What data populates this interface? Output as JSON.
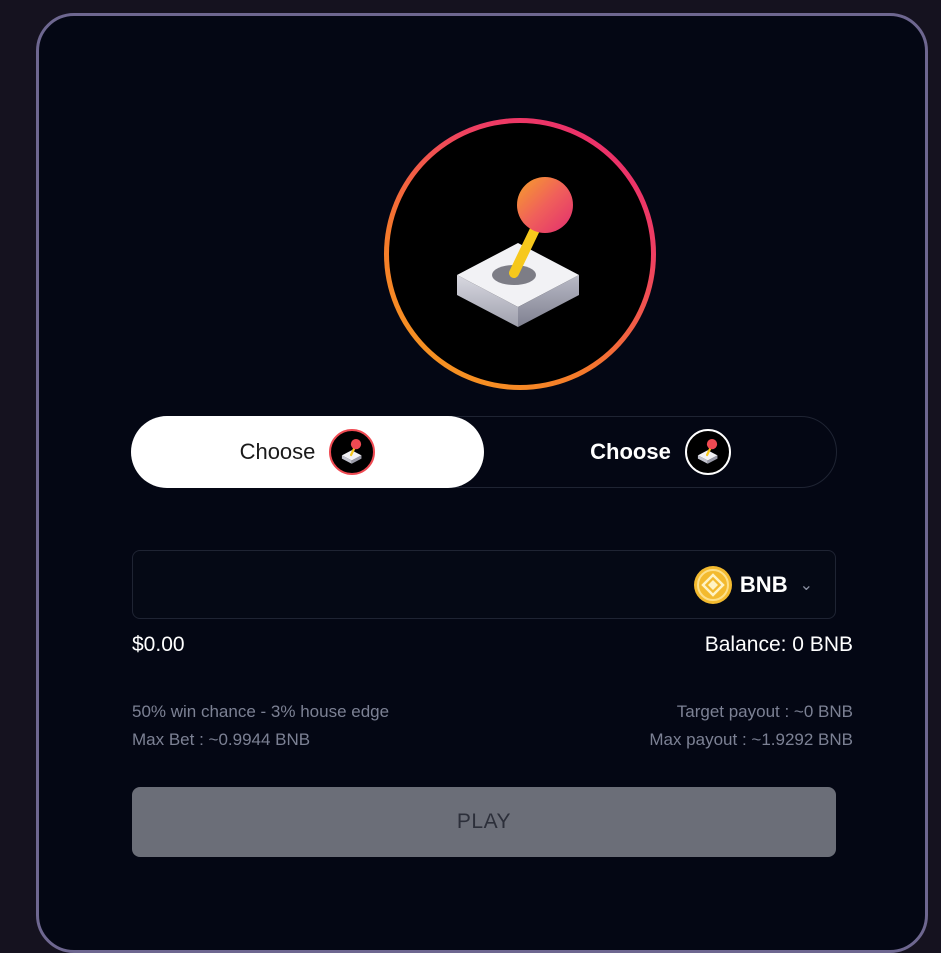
{
  "hero": {
    "icon": "joystick-icon",
    "ring_gradient": [
      "#f7a21b",
      "#e8256f"
    ]
  },
  "toggle": {
    "option_1": {
      "label": "Choose",
      "icon": "joystick-icon",
      "selected": true
    },
    "option_2": {
      "label": "Choose",
      "icon": "joystick-icon",
      "selected": false
    }
  },
  "bet": {
    "amount_value": "",
    "token": {
      "symbol": "BNB",
      "icon": "bnb-coin-icon",
      "color": "#f3ba2f"
    },
    "usd_value": "$0.00",
    "balance": "Balance: 0 BNB"
  },
  "info": {
    "win_chance": "50% win chance - 3% house edge",
    "max_bet": "Max Bet : ~0.9944 BNB",
    "target_payout": "Target payout : ~0 BNB",
    "max_payout": "Max payout : ~1.9292 BNB"
  },
  "play_button": {
    "label": "PLAY",
    "enabled": false
  },
  "colors": {
    "background": "#15121f",
    "card": "#040714",
    "card_border": "#6e6790",
    "accent_orange": "#f5782c",
    "accent_pink": "#e8256f",
    "button_disabled": "#6b6e78"
  }
}
